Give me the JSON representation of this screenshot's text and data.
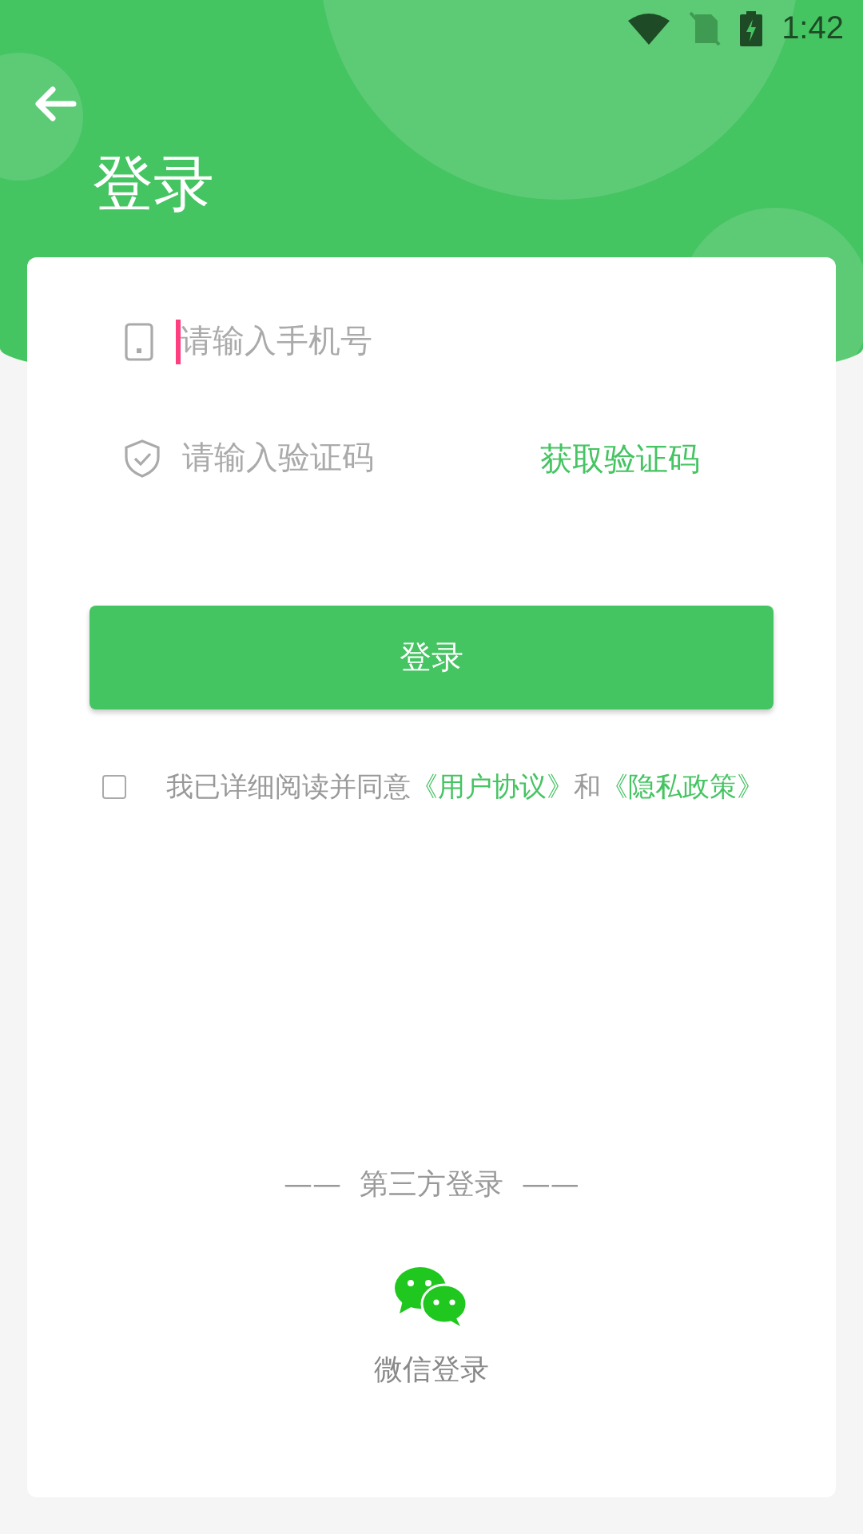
{
  "status_bar": {
    "time": "1:42"
  },
  "header": {
    "title": "登录"
  },
  "fields": [
    {
      "kind": "phone",
      "placeholder": "请输入手机号",
      "focused": true
    },
    {
      "kind": "code",
      "placeholder": "请输入验证码",
      "focused": false,
      "action": "获取验证码"
    }
  ],
  "login_button": "登录",
  "agreement": {
    "checked": false,
    "parts": [
      {
        "kind": "text",
        "text": "我已详细阅读并同意"
      },
      {
        "kind": "link",
        "text": "《用户协议》"
      },
      {
        "kind": "text",
        "text": "和"
      },
      {
        "kind": "link",
        "text": "《隐私政策》"
      }
    ]
  },
  "third_party": {
    "heading": "——  第三方登录  ——",
    "options": [
      {
        "kind": "wechat",
        "label": "微信登录"
      }
    ]
  }
}
